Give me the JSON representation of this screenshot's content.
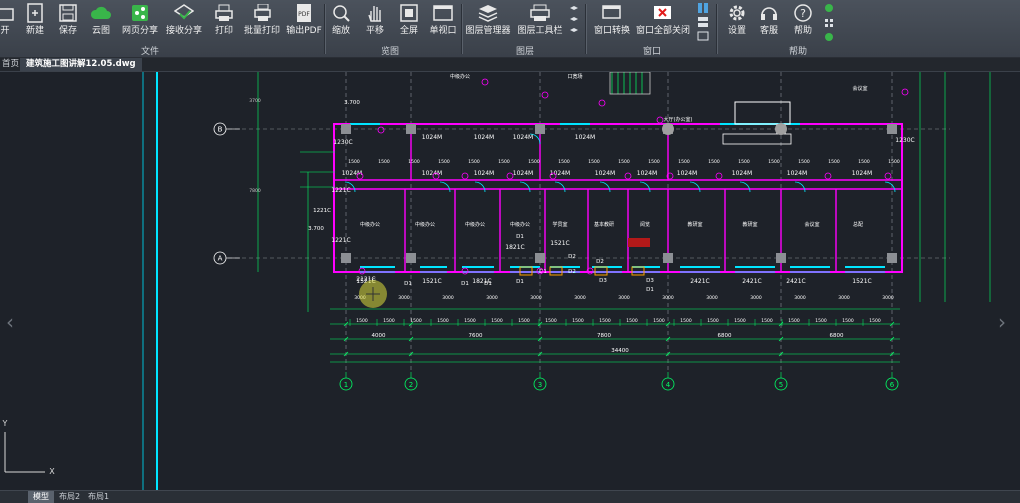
{
  "ribbon": {
    "file_group": {
      "label": "文件",
      "items": [
        {
          "name": "open",
          "label": "开"
        },
        {
          "name": "new",
          "label": "新建"
        },
        {
          "name": "save",
          "label": "保存"
        },
        {
          "name": "cloud",
          "label": "云图"
        },
        {
          "name": "web-share",
          "label": "网页分享"
        },
        {
          "name": "receive-share",
          "label": "接收分享"
        },
        {
          "name": "print",
          "label": "打印"
        },
        {
          "name": "batch-print",
          "label": "批量打印"
        },
        {
          "name": "export-pdf",
          "label": "输出PDF"
        }
      ]
    },
    "view_group": {
      "label": "览图",
      "items": [
        {
          "name": "zoom",
          "label": "缩放"
        },
        {
          "name": "pan",
          "label": "平移"
        },
        {
          "name": "fullscreen",
          "label": "全屏"
        },
        {
          "name": "single-viewport",
          "label": "单视口"
        }
      ]
    },
    "layer_group": {
      "label": "图层",
      "items": [
        {
          "name": "layer-manager",
          "label": "图层管理器"
        },
        {
          "name": "layer-toolbar",
          "label": "图层工具栏"
        }
      ]
    },
    "window_group": {
      "label": "窗口",
      "items": [
        {
          "name": "window-switch",
          "label": "窗口转换"
        },
        {
          "name": "close-all-windows",
          "label": "窗口全部关闭"
        }
      ]
    },
    "help_group": {
      "label": "帮助",
      "items": [
        {
          "name": "settings",
          "label": "设置"
        },
        {
          "name": "support",
          "label": "客服"
        },
        {
          "name": "help",
          "label": "帮助"
        }
      ]
    },
    "pdf_badge": "PDF"
  },
  "tabs": [
    {
      "label": "首页",
      "active": false
    },
    {
      "label": "建筑施工图讲解12.05.dwg",
      "active": true
    }
  ],
  "bottom_tabs": [
    {
      "label": "模型",
      "active": true
    },
    {
      "label": "布局2",
      "active": false
    },
    {
      "label": "布局1",
      "active": false
    }
  ],
  "drawing": {
    "grid_cols": [
      "1",
      "2",
      "3",
      "4",
      "5",
      "6"
    ],
    "grid_rows": [
      "B",
      "A"
    ],
    "total_dim": "34400",
    "bay_dims": [
      "4000",
      "7600",
      "7800",
      "6800",
      "6800"
    ],
    "top_labels": [
      "中级办公",
      "口宽场",
      "大厅(办公室)",
      "会议室"
    ],
    "room_labels": [
      "中级办公",
      "中级办公",
      "中级办公",
      "中级办公",
      "学员室",
      "基本教研",
      "阅览",
      "教研室",
      "教研室",
      "会议室",
      "总配"
    ],
    "door_labels": [
      "1024M",
      "1024M",
      "1024M",
      "1024M",
      "1024M",
      "1024M",
      "1024M",
      "1024M",
      "1024M",
      "1024M",
      "1024M",
      "1024M",
      "1024M",
      "1024M",
      "1024M"
    ],
    "window_labels": [
      "1521C",
      "1521C",
      "1821C",
      "1821C",
      "1521C",
      "2421C",
      "2421C",
      "2421C",
      "2421C",
      "1521C",
      "2121C",
      "1221C",
      "1221C",
      "1230C",
      "1230C"
    ],
    "small_labels": [
      "D1",
      "D1",
      "D1",
      "D1",
      "D2",
      "D2",
      "D3",
      "D1",
      "D3",
      "D2",
      "D1",
      "D1"
    ],
    "elev_labels": [
      "3.700",
      "3.700"
    ],
    "y_axis_label": "Y",
    "x_axis_label": "X"
  },
  "colors": {
    "ribbon": "#434a53",
    "canvas": "#1e2229",
    "wall": "#ff00ff",
    "dim": "#00ff66",
    "grid": "#ffffff",
    "cyan": "#00e5ff",
    "yellow": "#ffff00",
    "red": "#ff2020"
  }
}
